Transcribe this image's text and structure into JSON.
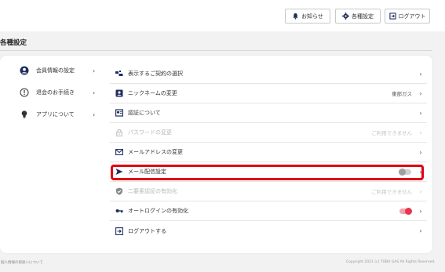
{
  "header": {
    "notice_label": "お知らせ",
    "settings_label": "各種設定",
    "logout_label": "ログアウト"
  },
  "page_title": "各種設定",
  "sidebar": {
    "items": [
      {
        "label": "会員情報の設定",
        "icon": "user-circle-icon"
      },
      {
        "label": "退会のお手続き",
        "icon": "exclamation-circle-icon"
      },
      {
        "label": "アプリについて",
        "icon": "lightbulb-icon"
      }
    ]
  },
  "menu": {
    "rows": [
      {
        "label": "表示するご契約の選択",
        "icon": "switch-icon",
        "value": "",
        "state": "enabled"
      },
      {
        "label": "ニックネームの変更",
        "icon": "id-card-icon",
        "value": "東部ガス",
        "state": "enabled"
      },
      {
        "label": "認証について",
        "icon": "auth-icon",
        "value": "",
        "state": "enabled"
      },
      {
        "label": "パスワードの変更",
        "icon": "lock-icon",
        "value": "ご利用できません",
        "state": "disabled"
      },
      {
        "label": "メールアドレスの変更",
        "icon": "envelope-icon",
        "value": "",
        "state": "enabled"
      },
      {
        "label": "メール配信設定",
        "icon": "send-icon",
        "value": "",
        "state": "enabled",
        "toggle": "off"
      },
      {
        "label": "二要素認証の有効化",
        "icon": "shield-check-icon",
        "value": "ご利用できません",
        "state": "disabled"
      },
      {
        "label": "オートログインの有効化",
        "icon": "key-icon",
        "value": "",
        "state": "enabled",
        "toggle": "on"
      },
      {
        "label": "ログアウトする",
        "icon": "logout-icon",
        "value": "",
        "state": "enabled"
      }
    ]
  },
  "footer": {
    "left": "個人情報の取扱いについて",
    "right": "Copyright 2021 (c) TOBU GAS All Rights Reserved."
  },
  "colors": {
    "accent_red": "#e00012",
    "toggle_on": "#e8344e",
    "toggle_off": "#9e9e9e"
  }
}
